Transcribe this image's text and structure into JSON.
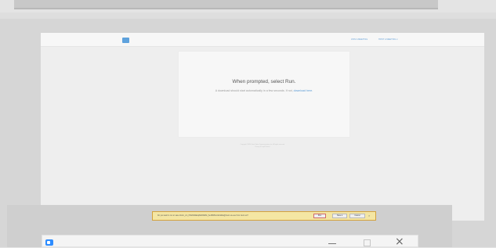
{
  "header": {
    "links": [
      "JOIN A MEETING",
      "HOST A MEETING ▾"
    ]
  },
  "card": {
    "title": "When prompted, select Run.",
    "subtitle_text": "A download should start automatically in a few seconds. If not, ",
    "subtitle_link": "download here."
  },
  "footer": {
    "copyright": "Copyright ©2020 Zoom Video Communications, Inc. All rights reserved.",
    "policy": "Privacy & Legal Policies"
  },
  "download_bar": {
    "message": "Do you want to run or save Zoom_cm_fXtGbMnEkq8s0AWMm_6e4f0b81ccdd1d2a@zoom.us.exe from zoom.us?",
    "run_label": "Run",
    "save_label": "Save ▾",
    "cancel_label": "Cancel",
    "close_icon": "close-icon"
  },
  "window": {
    "app_icon": "zoom-app-icon",
    "minimize_icon": "minimize-icon",
    "maximize_icon": "maximize-icon",
    "close_icon": "close-icon"
  },
  "colors": {
    "accent": "#5b9bd5",
    "download_bar_bg": "#f4e6a3",
    "app_icon": "#2d8cff"
  }
}
